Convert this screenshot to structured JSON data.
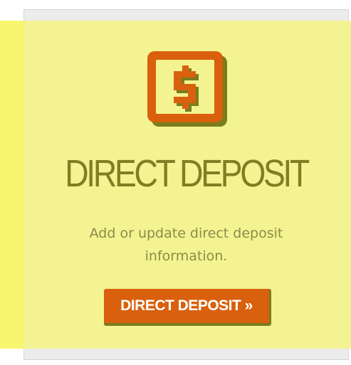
{
  "card": {
    "title": "DIRECT DEPOSIT",
    "description": "Add or update direct deposit information.",
    "button_label": "DIRECT DEPOSIT »",
    "icon": "dollar-icon"
  },
  "colors": {
    "accent": "#d9600c",
    "highlight": "#f4f392",
    "title_text": "#7f7e22",
    "body_text": "#8c8b48"
  }
}
